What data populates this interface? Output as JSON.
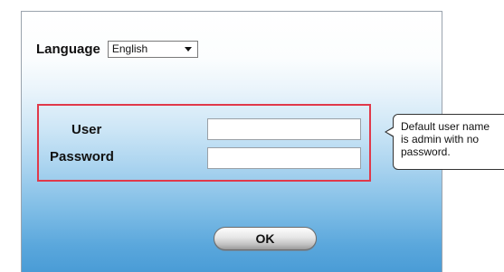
{
  "language": {
    "label": "Language",
    "selected": "English"
  },
  "credentials": {
    "user_label": "User",
    "user_value": "",
    "password_label": "Password",
    "password_value": ""
  },
  "ok_label": "OK",
  "callout": {
    "lines": [
      "Default user name",
      "is admin with no",
      "password."
    ]
  },
  "colors": {
    "highlight_border": "#e0394a",
    "panel_gradient_bottom": "#4a9cd6"
  }
}
